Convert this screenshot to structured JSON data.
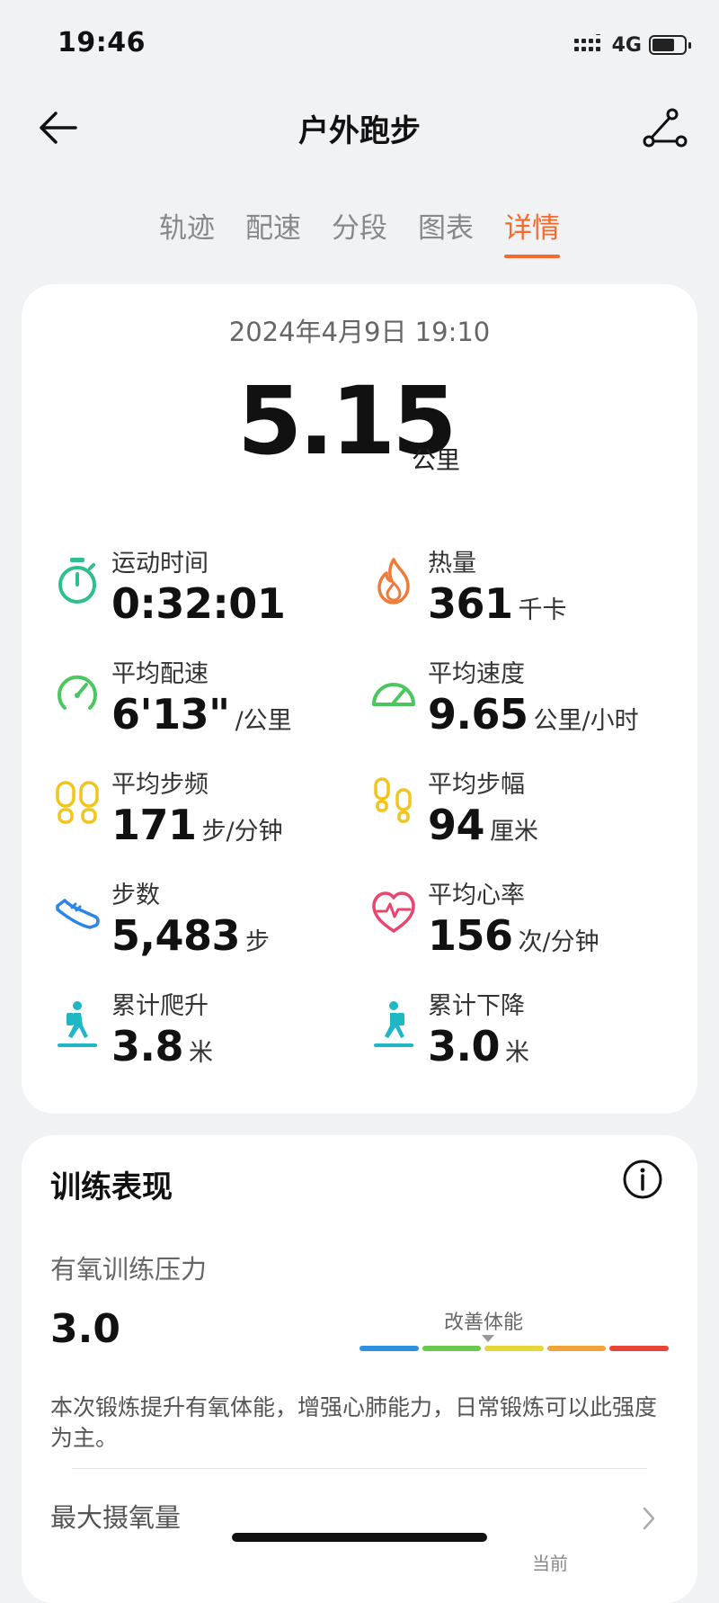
{
  "status_bar": {
    "time": "19:46",
    "network": "4G",
    "battery_level": 0.7
  },
  "nav": {
    "title": "户外跑步"
  },
  "tabs": [
    {
      "label": "轨迹",
      "active": false
    },
    {
      "label": "配速",
      "active": false
    },
    {
      "label": "分段",
      "active": false
    },
    {
      "label": "图表",
      "active": false
    },
    {
      "label": "详情",
      "active": true
    }
  ],
  "summary": {
    "datetime": "2024年4月9日 19:10",
    "distance": "5.15",
    "distance_unit": "公里",
    "metrics": [
      {
        "label": "运动时间",
        "value": "0:32:01",
        "unit": "",
        "icon": "stopwatch-icon",
        "color": "#2fbf8e"
      },
      {
        "label": "热量",
        "value": "361",
        "unit": "千卡",
        "icon": "flame-icon",
        "color": "#f07a3a"
      },
      {
        "label": "平均配速",
        "value": "6'13\"",
        "unit": "/公里",
        "icon": "pace-gauge-icon",
        "color": "#4cc760"
      },
      {
        "label": "平均速度",
        "value": "9.65",
        "unit": "公里/小时",
        "icon": "speedometer-icon",
        "color": "#4cc760"
      },
      {
        "label": "平均步频",
        "value": "171",
        "unit": "步/分钟",
        "icon": "footprints-icon",
        "color": "#f2c51e"
      },
      {
        "label": "平均步幅",
        "value": "94",
        "unit": "厘米",
        "icon": "footprints-stride-icon",
        "color": "#f2c51e"
      },
      {
        "label": "步数",
        "value": "5,483",
        "unit": "步",
        "icon": "shoe-icon",
        "color": "#2b84e6"
      },
      {
        "label": "平均心率",
        "value": "156",
        "unit": "次/分钟",
        "icon": "heart-rate-icon",
        "color": "#e9466e"
      },
      {
        "label": "累计爬升",
        "value": "3.8",
        "unit": "米",
        "icon": "hiker-climb-icon",
        "color": "#1fb7c4"
      },
      {
        "label": "累计下降",
        "value": "3.0",
        "unit": "米",
        "icon": "hiker-descend-icon",
        "color": "#1fb7c4"
      }
    ]
  },
  "training": {
    "title": "训练表现",
    "aerobic_label": "有氧训练压力",
    "aerobic_value": "3.0",
    "scale_label": "改善体能",
    "scale_colors": [
      "#2f8fe0",
      "#6cc94e",
      "#e8d53a",
      "#f2a33a",
      "#e8453a"
    ],
    "description": "本次锻炼提升有氧体能，增强心肺能力，日常锻炼可以此强度为主。",
    "vo2_label": "最大摄氧量",
    "vo2_extra": "当前"
  }
}
